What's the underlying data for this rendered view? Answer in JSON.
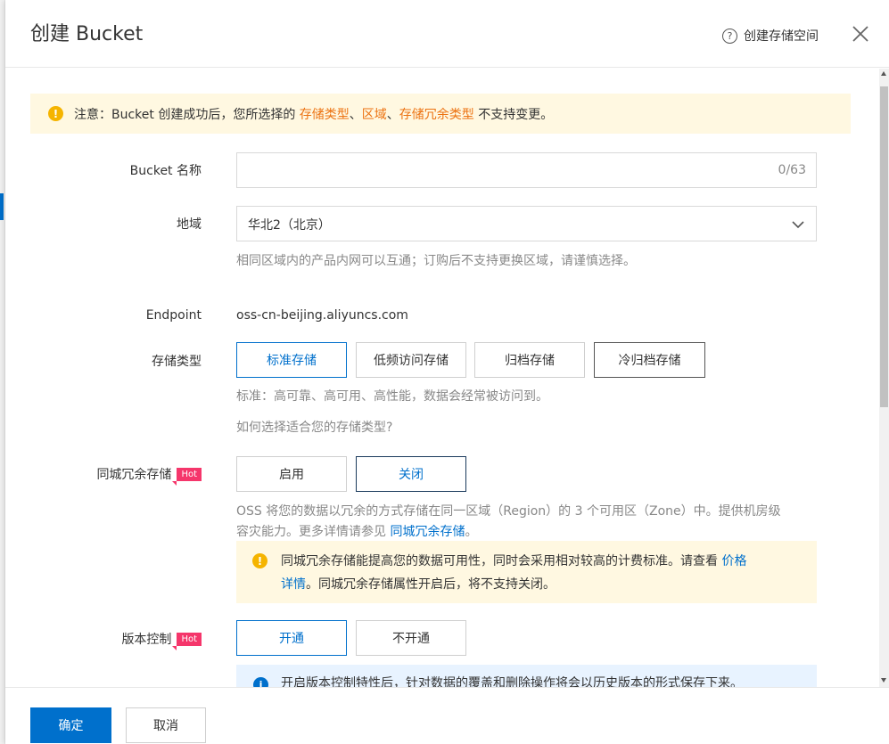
{
  "dialog": {
    "title": "创建 Bucket",
    "help_label": "创建存储空间"
  },
  "notice": {
    "prefix": "注意：Bucket 创建成功后，您所选择的 ",
    "hl1": "存储类型",
    "sep1": "、",
    "hl2": "区域",
    "sep2": "、",
    "hl3": "存储冗余类型",
    "suffix": " 不支持变更。"
  },
  "form": {
    "bucket_name": {
      "label": "Bucket 名称",
      "value": "",
      "counter": "0/63"
    },
    "region": {
      "label": "地域",
      "value": "华北2（北京）",
      "hint": "相同区域内的产品内网可以互通；订购后不支持更换区域，请谨慎选择。"
    },
    "endpoint": {
      "label": "Endpoint",
      "value": "oss-cn-beijing.aliyuncs.com"
    },
    "storage_class": {
      "label": "存储类型",
      "options": [
        "标准存储",
        "低频访问存储",
        "归档存储",
        "冷归档存储"
      ],
      "selected": "标准存储",
      "hint": "标准：高可靠、高可用、高性能，数据会经常被访问到。",
      "link": "如何选择适合您的存储类型?"
    },
    "zone_redundant": {
      "label": "同城冗余存储",
      "badge": "Hot",
      "options": [
        "启用",
        "关闭"
      ],
      "selected": "关闭",
      "hint_line1": "OSS 将您的数据以冗余的方式存储在同一区域（Region）的 3 个可用区（Zone）中。提供机房级",
      "hint_line2_prefix": "容灾能力。更多详情请参见 ",
      "hint_link": "同城冗余存储",
      "hint_line2_suffix": "。",
      "warn_line1": "同城冗余存储能提高您的数据可用性，同时会采用相对较高的计费标准。请查看 ",
      "warn_link_part1": "价格",
      "warn_link_part2": "详情",
      "warn_line2_suffix": "。同城冗余存储属性开启后，将不支持关闭。"
    },
    "versioning": {
      "label": "版本控制",
      "badge": "Hot",
      "options": [
        "开通",
        "不开通"
      ],
      "selected": "开通",
      "info": "开启版本控制特性后，针对数据的覆盖和删除操作将会以历史版本的形式保存下来。"
    }
  },
  "footer": {
    "confirm": "确定",
    "cancel": "取消"
  },
  "colors": {
    "primary": "#0070cc",
    "warning_bg": "#fff8e1",
    "warning_icon": "#f5b400",
    "highlight": "#ec7211",
    "hot_badge": "#f5366b"
  }
}
